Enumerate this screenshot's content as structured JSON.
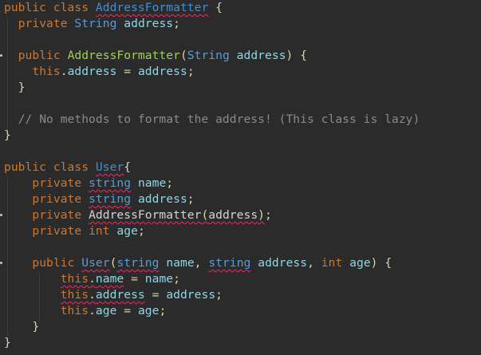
{
  "colors": {
    "background": "#2b2b2b",
    "keyword": "#cc7832",
    "type": "#5b9bd5",
    "method_name": "#9fcf5a",
    "class_decl": "#3e8fd8",
    "identifier": "#8ad9e8",
    "comment": "#8a8a8a",
    "error_squiggle": "#e0306a"
  },
  "code": {
    "l1": {
      "kw1": "public",
      "kw2": "class",
      "cls": "AddressFormatter",
      "brace": "{"
    },
    "l2": {
      "kw": "private",
      "type": "String",
      "field": "address",
      "semi": ";"
    },
    "l4": {
      "kw": "public",
      "ctor": "AddressFormatter",
      "open": "(",
      "type": "String",
      "param": "address",
      "close": ")",
      "brace": "{"
    },
    "l5": {
      "this": "this",
      "dot": ".",
      "field": "address",
      "eq": "=",
      "rhs": "address",
      "semi": ";"
    },
    "l6": {
      "brace": "}"
    },
    "l8": {
      "comment": "// No methods to format the address! (This class is lazy)"
    },
    "l9": {
      "brace": "}"
    },
    "l11": {
      "kw1": "public",
      "kw2": "class",
      "cls": "User",
      "brace": "{"
    },
    "l12": {
      "kw": "private",
      "type": "string",
      "field": "name",
      "semi": ";"
    },
    "l13": {
      "kw": "private",
      "type": "string",
      "field": "address",
      "semi": ";"
    },
    "l14": {
      "kw": "private",
      "expr": "AddressFormatter",
      "open": "(",
      "arg": "address",
      "close": ")",
      "semi": ";"
    },
    "l15": {
      "kw": "private",
      "type": "int",
      "field": "age",
      "semi": ";"
    },
    "l17": {
      "kw": "public",
      "ctor": "User",
      "open": "(",
      "t1": "string",
      "p1": "name",
      "comma1": ",",
      "t2": "string",
      "p2": "address",
      "comma2": ",",
      "t3": "int",
      "p3": "age",
      "close": ")",
      "brace": "{"
    },
    "l18": {
      "this": "this",
      "dot": ".",
      "field": "name",
      "eq": "=",
      "rhs": "name",
      "semi": ";"
    },
    "l19": {
      "this": "this",
      "dot": ".",
      "field": "address",
      "eq": "=",
      "rhs": "address",
      "semi": ";"
    },
    "l20": {
      "this": "this",
      "dot": ".",
      "field": "age",
      "eq": "=",
      "rhs": "age",
      "semi": ";"
    },
    "l21": {
      "brace": "}"
    },
    "l22": {
      "brace": "}"
    }
  }
}
